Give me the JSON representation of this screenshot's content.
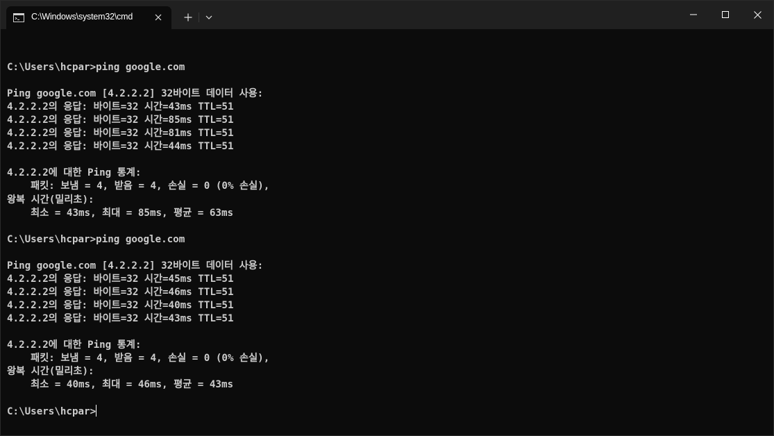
{
  "window": {
    "tab_title": "C:\\Windows\\system32\\cmd",
    "tab_icon": "console-icon",
    "controls": [
      "minimize-icon",
      "maximize-icon",
      "close-icon"
    ]
  },
  "terminal": {
    "lines": [
      "",
      "C:\\Users\\hcpar>ping google.com",
      "",
      "Ping google.com [4.2.2.2] 32바이트 데이터 사용:",
      "4.2.2.2의 응답: 바이트=32 시간=43ms TTL=51",
      "4.2.2.2의 응답: 바이트=32 시간=85ms TTL=51",
      "4.2.2.2의 응답: 바이트=32 시간=81ms TTL=51",
      "4.2.2.2의 응답: 바이트=32 시간=44ms TTL=51",
      "",
      "4.2.2.2에 대한 Ping 통계:",
      "    패킷: 보냄 = 4, 받음 = 4, 손실 = 0 (0% 손실),",
      "왕복 시간(밀리초):",
      "    최소 = 43ms, 최대 = 85ms, 평균 = 63ms",
      "",
      "C:\\Users\\hcpar>ping google.com",
      "",
      "Ping google.com [4.2.2.2] 32바이트 데이터 사용:",
      "4.2.2.2의 응답: 바이트=32 시간=45ms TTL=51",
      "4.2.2.2의 응답: 바이트=32 시간=46ms TTL=51",
      "4.2.2.2의 응답: 바이트=32 시간=40ms TTL=51",
      "4.2.2.2의 응답: 바이트=32 시간=43ms TTL=51",
      "",
      "4.2.2.2에 대한 Ping 통계:",
      "    패킷: 보냄 = 4, 받음 = 4, 손실 = 0 (0% 손실),",
      "왕복 시간(밀리초):",
      "    최소 = 40ms, 최대 = 46ms, 평균 = 43ms",
      ""
    ],
    "prompt": "C:\\Users\\hcpar>",
    "colors": {
      "background": "#0c0c0c",
      "foreground": "#cccccc",
      "titlebar": "#202020"
    }
  }
}
